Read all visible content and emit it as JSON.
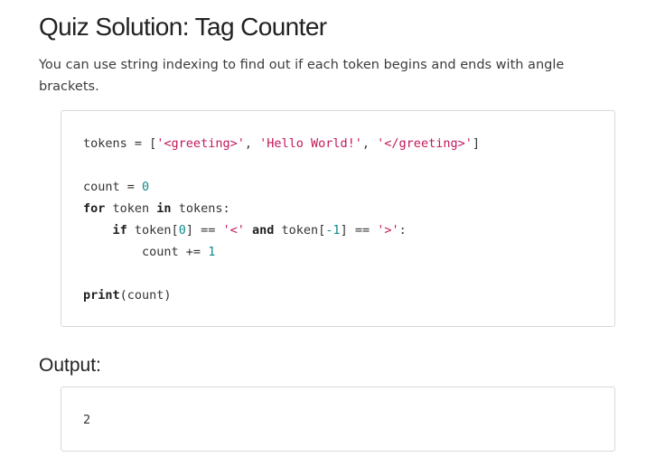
{
  "page": {
    "title": "Quiz Solution: Tag Counter",
    "intro": "You can use string indexing to find out if each token begins and ends with angle brackets."
  },
  "code_block": {
    "line1": {
      "var": "tokens",
      "op": " = [",
      "s1": "'<greeting>'",
      "sep1": ", ",
      "s2": "'Hello World!'",
      "sep2": ", ",
      "s3": "'</greeting>'",
      "close": "]"
    },
    "line2": {
      "var": "count",
      "op": " = ",
      "num": "0"
    },
    "line3": {
      "kw_for": "for",
      "mid1": " token ",
      "kw_in": "in",
      "mid2": " tokens:"
    },
    "line4": {
      "kw_if": "if",
      "mid1": " token[",
      "idx1": "0",
      "mid2": "] == ",
      "s1": "'<'",
      "sp": " ",
      "kw_and": "and",
      "mid3": " token[",
      "idx2": "-1",
      "mid4": "] == ",
      "s2": "'>'",
      "end": ":"
    },
    "line5": {
      "var": "count",
      "op": " += ",
      "num": "1"
    },
    "line6": {
      "kw_print": "print",
      "args": "(count)"
    }
  },
  "output": {
    "heading": "Output:",
    "value": "2"
  },
  "colors": {
    "string": "#c2185b",
    "number": "#0f8a8a",
    "border": "#d9d9d9"
  }
}
